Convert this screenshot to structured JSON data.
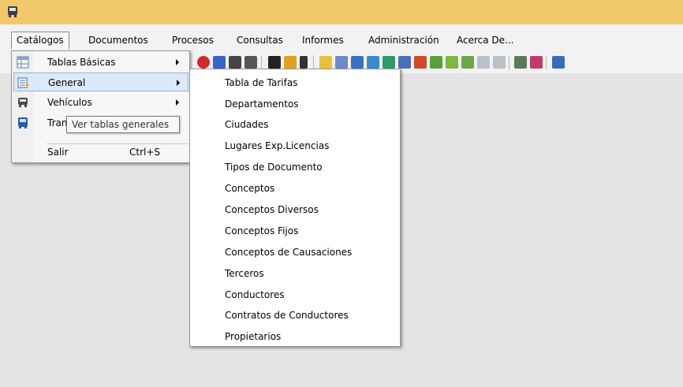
{
  "window": {
    "app_icon": "bus-icon"
  },
  "menubar": {
    "items": [
      "Catálogos",
      "Documentos",
      "Procesos",
      "Consultas",
      "Informes",
      "Administración",
      "Acerca De..."
    ]
  },
  "catalogos_menu": {
    "items": [
      {
        "label": "Tablas Básicas",
        "icon": "table-grid-icon",
        "has_submenu": true
      },
      {
        "label": "General",
        "icon": "list-doc-icon",
        "has_submenu": true,
        "highlighted": true
      },
      {
        "label": "Vehículos",
        "icon": "bus-icon",
        "has_submenu": true
      },
      {
        "label": "Tran",
        "icon": "bus-blue-icon",
        "has_submenu": false
      }
    ],
    "exit": {
      "label": "Salir",
      "shortcut": "Ctrl+S"
    }
  },
  "tooltip": {
    "text": "Ver tablas generales"
  },
  "general_submenu": {
    "items": [
      "Tabla de Tarifas",
      "Departamentos",
      "Ciudades",
      "Lugares Exp.Licencias",
      "Tipos de Documento",
      "Conceptos",
      "Conceptos Diversos",
      "Conceptos Fijos",
      "Conceptos de Causaciones",
      "Terceros",
      "Conductores",
      "Contratos de Conductores",
      "Propietarios"
    ]
  },
  "colors": {
    "titlebar": "#f2c96a",
    "menu_highlight": "#dce9f8",
    "workspace": "#e3e3e3"
  }
}
